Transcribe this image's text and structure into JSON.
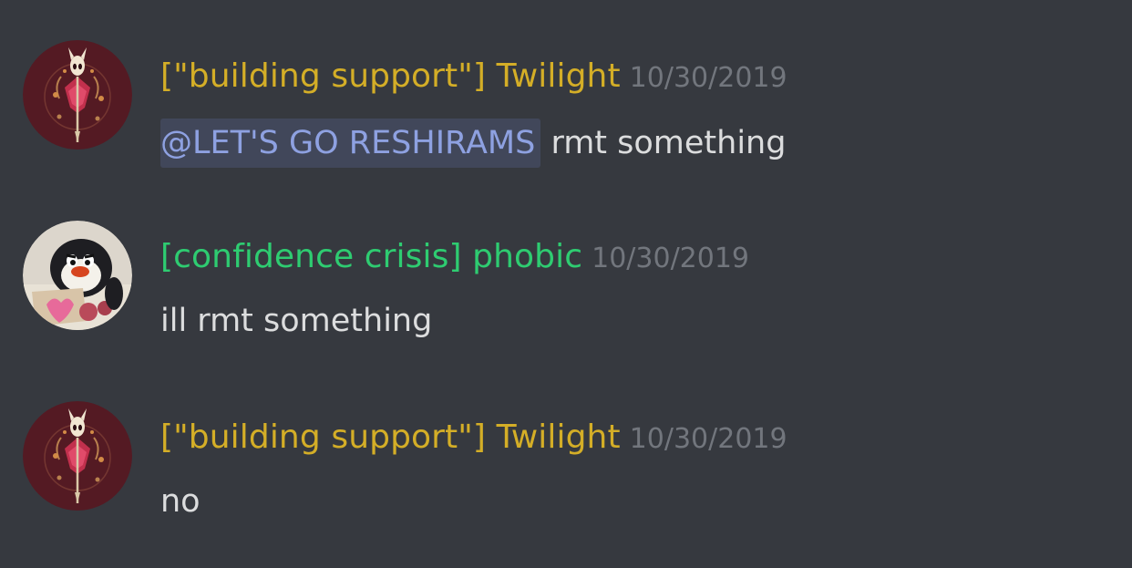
{
  "colors": {
    "background": "#36393f",
    "twilight_role": "#d4ae27",
    "phobic_role": "#2ecc71",
    "timestamp": "#72767d",
    "message_text": "#dcddde",
    "mention_text": "#8ea1e1",
    "mention_bg": "#3c4270"
  },
  "messages": [
    {
      "username": "[\"building support\"] Twilight",
      "timestamp": "10/30/2019",
      "mention": "@LET'S GO RESHIRAMS",
      "text": " rmt something",
      "avatar_icon": "hollow-knight-hornet-avatar-icon"
    },
    {
      "username": "[confidence crisis] phobic",
      "timestamp": "10/30/2019",
      "text": "ill rmt something",
      "avatar_icon": "pingu-penguin-avatar-icon"
    },
    {
      "username": "[\"building support\"] Twilight",
      "timestamp": "10/30/2019",
      "text": "no",
      "avatar_icon": "hollow-knight-hornet-avatar-icon"
    }
  ]
}
